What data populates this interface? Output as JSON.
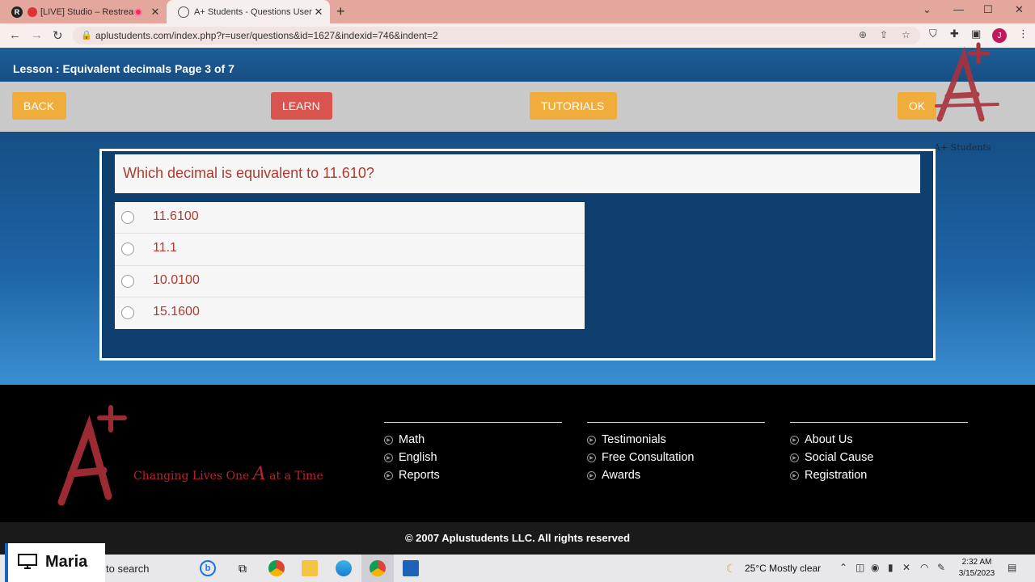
{
  "browser": {
    "tabs": [
      {
        "title": "[LIVE] Studio – Restream",
        "favicon": "R"
      },
      {
        "title": "A+ Students - Questions User",
        "favicon": "globe"
      }
    ],
    "url": "aplustudents.com/index.php?r=user/questions&id=1627&indexid=746&indent=2",
    "profile_initial": "J"
  },
  "page": {
    "lesson_title": "Lesson : Equivalent decimals Page 3 of 7",
    "buttons": {
      "back": "BACK",
      "learn": "LEARN",
      "tutorials": "TUTORIALS",
      "ok": "OK"
    },
    "brand_caption": "A+ Students",
    "question": "Which decimal is equivalent to 11.610?",
    "options": [
      "11.6100",
      "11.1",
      "10.0100",
      "15.1600"
    ]
  },
  "footer": {
    "slogan_pre": "Changing Lives One",
    "slogan_a": "A",
    "slogan_post": "at a Time",
    "columns": [
      [
        "Math",
        "English",
        "Reports"
      ],
      [
        "Testimonials",
        "Free Consultation",
        "Awards"
      ],
      [
        "About Us",
        "Social Cause",
        "Registration"
      ]
    ],
    "copyright": "© 2007 Aplustudents LLC. All rights reserved"
  },
  "taskbar": {
    "search_text": "to search",
    "weather": "25°C  Mostly clear",
    "time": "2:32 AM",
    "date": "3/15/2023",
    "presenter": "Maria"
  }
}
